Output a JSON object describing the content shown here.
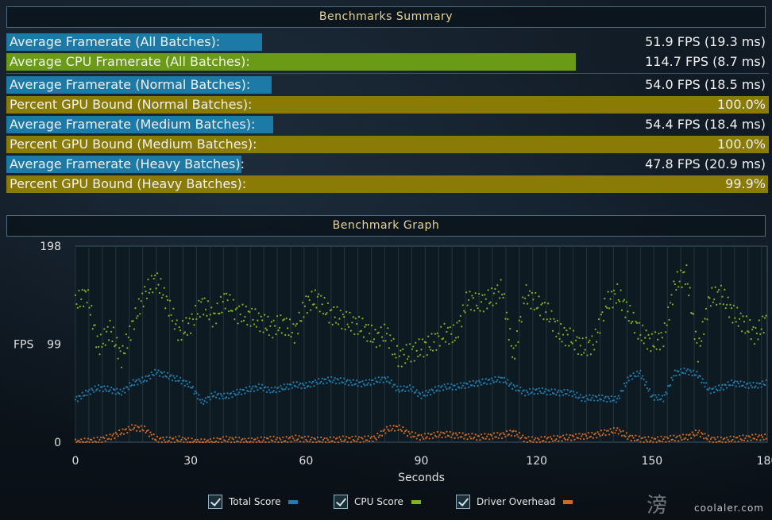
{
  "summary": {
    "title": "Benchmarks Summary",
    "rows": [
      {
        "label": "Average Framerate (All Batches):",
        "value": "51.9 FPS (19.3 ms)",
        "fill": 0.335,
        "color": "#1d7aa6"
      },
      {
        "label": "Average CPU Framerate (All Batches):",
        "value": "114.7 FPS (8.7 ms)",
        "fill": 0.747,
        "color": "#6b9a17"
      },
      {
        "label": "Average Framerate (Normal Batches):",
        "value": "54.0 FPS (18.5 ms)",
        "fill": 0.348,
        "color": "#1d7aa6"
      },
      {
        "label": "Percent GPU Bound (Normal Batches):",
        "value": "100.0%",
        "fill": 1.0,
        "color": "#8a7a06"
      },
      {
        "label": "Average Framerate (Medium Batches):",
        "value": "54.4 FPS (18.4 ms)",
        "fill": 0.35,
        "color": "#1d7aa6"
      },
      {
        "label": "Percent GPU Bound (Medium Batches):",
        "value": "100.0%",
        "fill": 1.0,
        "color": "#8a7a06"
      },
      {
        "label": "Average Framerate (Heavy Batches):",
        "value": "47.8 FPS (20.9 ms)",
        "fill": 0.308,
        "color": "#1d7aa6"
      },
      {
        "label": "Percent GPU Bound (Heavy Batches):",
        "value": "99.9%",
        "fill": 0.999,
        "color": "#8a7a06"
      }
    ]
  },
  "graph": {
    "title": "Benchmark Graph"
  },
  "chart_data": {
    "type": "scatter",
    "xlabel": "Seconds",
    "ylabel": "FPS",
    "xlim": [
      0,
      180
    ],
    "ylim": [
      0,
      198
    ],
    "xticks": [
      "0",
      "30",
      "60",
      "90",
      "120",
      "150",
      "180"
    ],
    "yticks": [
      "0",
      "99",
      "198"
    ],
    "grid": true,
    "legend_position": "bottom",
    "series": [
      {
        "name": "Total Score",
        "color": "#1f7fb0",
        "x": [
          0,
          3,
          6,
          9,
          12,
          15,
          18,
          21,
          24,
          27,
          30,
          33,
          36,
          39,
          42,
          45,
          48,
          51,
          54,
          57,
          60,
          63,
          66,
          69,
          72,
          75,
          78,
          81,
          84,
          87,
          90,
          93,
          96,
          99,
          102,
          105,
          108,
          111,
          114,
          117,
          120,
          123,
          126,
          129,
          132,
          135,
          138,
          141,
          144,
          147,
          150,
          153,
          156,
          159,
          162,
          165,
          168,
          171,
          174,
          177,
          180
        ],
        "y": [
          43,
          50,
          55,
          53,
          50,
          60,
          63,
          71,
          67,
          63,
          57,
          40,
          48,
          46,
          50,
          53,
          56,
          52,
          55,
          58,
          57,
          61,
          63,
          62,
          60,
          59,
          62,
          64,
          53,
          55,
          47,
          52,
          56,
          56,
          58,
          60,
          62,
          64,
          56,
          50,
          52,
          51,
          50,
          50,
          44,
          45,
          44,
          43,
          65,
          70,
          46,
          44,
          70,
          72,
          68,
          52,
          55,
          60,
          58,
          57,
          60
        ]
      },
      {
        "name": "CPU Score",
        "color": "#7fb51d",
        "x": [
          0,
          3,
          6,
          9,
          12,
          15,
          18,
          21,
          24,
          27,
          30,
          33,
          36,
          39,
          42,
          45,
          48,
          51,
          54,
          57,
          60,
          63,
          66,
          69,
          72,
          75,
          78,
          81,
          84,
          87,
          90,
          93,
          96,
          99,
          102,
          105,
          108,
          111,
          114,
          117,
          120,
          123,
          126,
          129,
          132,
          135,
          138,
          141,
          144,
          147,
          150,
          153,
          156,
          159,
          162,
          165,
          168,
          171,
          174,
          177,
          180
        ],
        "y": [
          140,
          150,
          95,
          115,
          85,
          120,
          150,
          165,
          140,
          110,
          120,
          140,
          125,
          145,
          130,
          128,
          122,
          115,
          120,
          110,
          140,
          145,
          130,
          125,
          120,
          115,
          105,
          110,
          85,
          90,
          95,
          100,
          110,
          108,
          145,
          140,
          145,
          155,
          85,
          150,
          140,
          130,
          110,
          105,
          95,
          100,
          140,
          150,
          130,
          110,
          100,
          105,
          160,
          170,
          90,
          145,
          150,
          130,
          120,
          108,
          125
        ]
      },
      {
        "name": "Driver Overhead",
        "color": "#d2691e",
        "x": [
          0,
          3,
          6,
          9,
          12,
          15,
          18,
          21,
          24,
          27,
          30,
          33,
          36,
          39,
          42,
          45,
          48,
          51,
          54,
          57,
          60,
          63,
          66,
          69,
          72,
          75,
          78,
          81,
          84,
          87,
          90,
          93,
          96,
          99,
          102,
          105,
          108,
          111,
          114,
          117,
          120,
          123,
          126,
          129,
          132,
          135,
          138,
          141,
          144,
          147,
          150,
          153,
          156,
          159,
          162,
          165,
          168,
          171,
          174,
          177,
          180
        ],
        "y": [
          0,
          1,
          2,
          5,
          10,
          15,
          13,
          3,
          2,
          3,
          1,
          0,
          1,
          3,
          2,
          1,
          2,
          3,
          2,
          4,
          3,
          2,
          2,
          3,
          3,
          3,
          4,
          13,
          15,
          8,
          5,
          7,
          8,
          7,
          6,
          5,
          6,
          7,
          10,
          3,
          2,
          3,
          4,
          5,
          6,
          7,
          10,
          12,
          5,
          3,
          2,
          3,
          4,
          5,
          10,
          3,
          2,
          3,
          4,
          5,
          5
        ]
      }
    ]
  },
  "legend": [
    {
      "label": "Total Score",
      "color": "#1f7fb0"
    },
    {
      "label": "CPU Score",
      "color": "#7fb51d"
    },
    {
      "label": "Driver Overhead",
      "color": "#d2691e"
    }
  ],
  "watermark": "coolaler.com",
  "watermark_glyph": "滂"
}
